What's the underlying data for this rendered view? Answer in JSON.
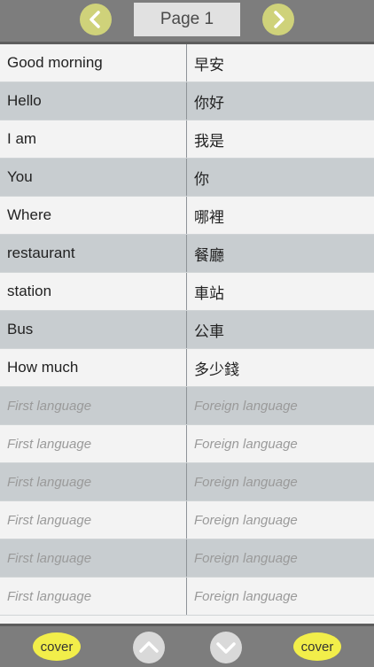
{
  "header": {
    "page_label": "Page 1",
    "prev_icon": "chevron-left-icon",
    "next_icon": "chevron-right-icon"
  },
  "rows": [
    {
      "first": "Good morning",
      "foreign": "早安",
      "placeholder": false
    },
    {
      "first": "Hello",
      "foreign": "你好",
      "placeholder": false
    },
    {
      "first": "I am",
      "foreign": "我是",
      "placeholder": false
    },
    {
      "first": "You",
      "foreign": "你",
      "placeholder": false
    },
    {
      "first": "Where",
      "foreign": "哪裡",
      "placeholder": false
    },
    {
      "first": "restaurant",
      "foreign": "餐廳",
      "placeholder": false
    },
    {
      "first": "station",
      "foreign": "車站",
      "placeholder": false
    },
    {
      "first": "Bus",
      "foreign": "公車",
      "placeholder": false
    },
    {
      "first": "How much",
      "foreign": "多少錢",
      "placeholder": false
    },
    {
      "first": "First language",
      "foreign": "Foreign language",
      "placeholder": true
    },
    {
      "first": "First language",
      "foreign": "Foreign language",
      "placeholder": true
    },
    {
      "first": "First language",
      "foreign": "Foreign language",
      "placeholder": true
    },
    {
      "first": "First language",
      "foreign": "Foreign language",
      "placeholder": true
    },
    {
      "first": "First language",
      "foreign": "Foreign language",
      "placeholder": true
    },
    {
      "first": "First language",
      "foreign": "Foreign language",
      "placeholder": true
    }
  ],
  "footer": {
    "cover_left_label": "cover",
    "cover_right_label": "cover",
    "up_icon": "chevron-up-icon",
    "down_icon": "chevron-down-icon"
  },
  "colors": {
    "bar": "#7d7d7d",
    "row_light": "#f3f3f3",
    "row_dark": "#c8cdd0",
    "nav_button": "#cfd27a",
    "cover_button": "#f2ee4a"
  }
}
